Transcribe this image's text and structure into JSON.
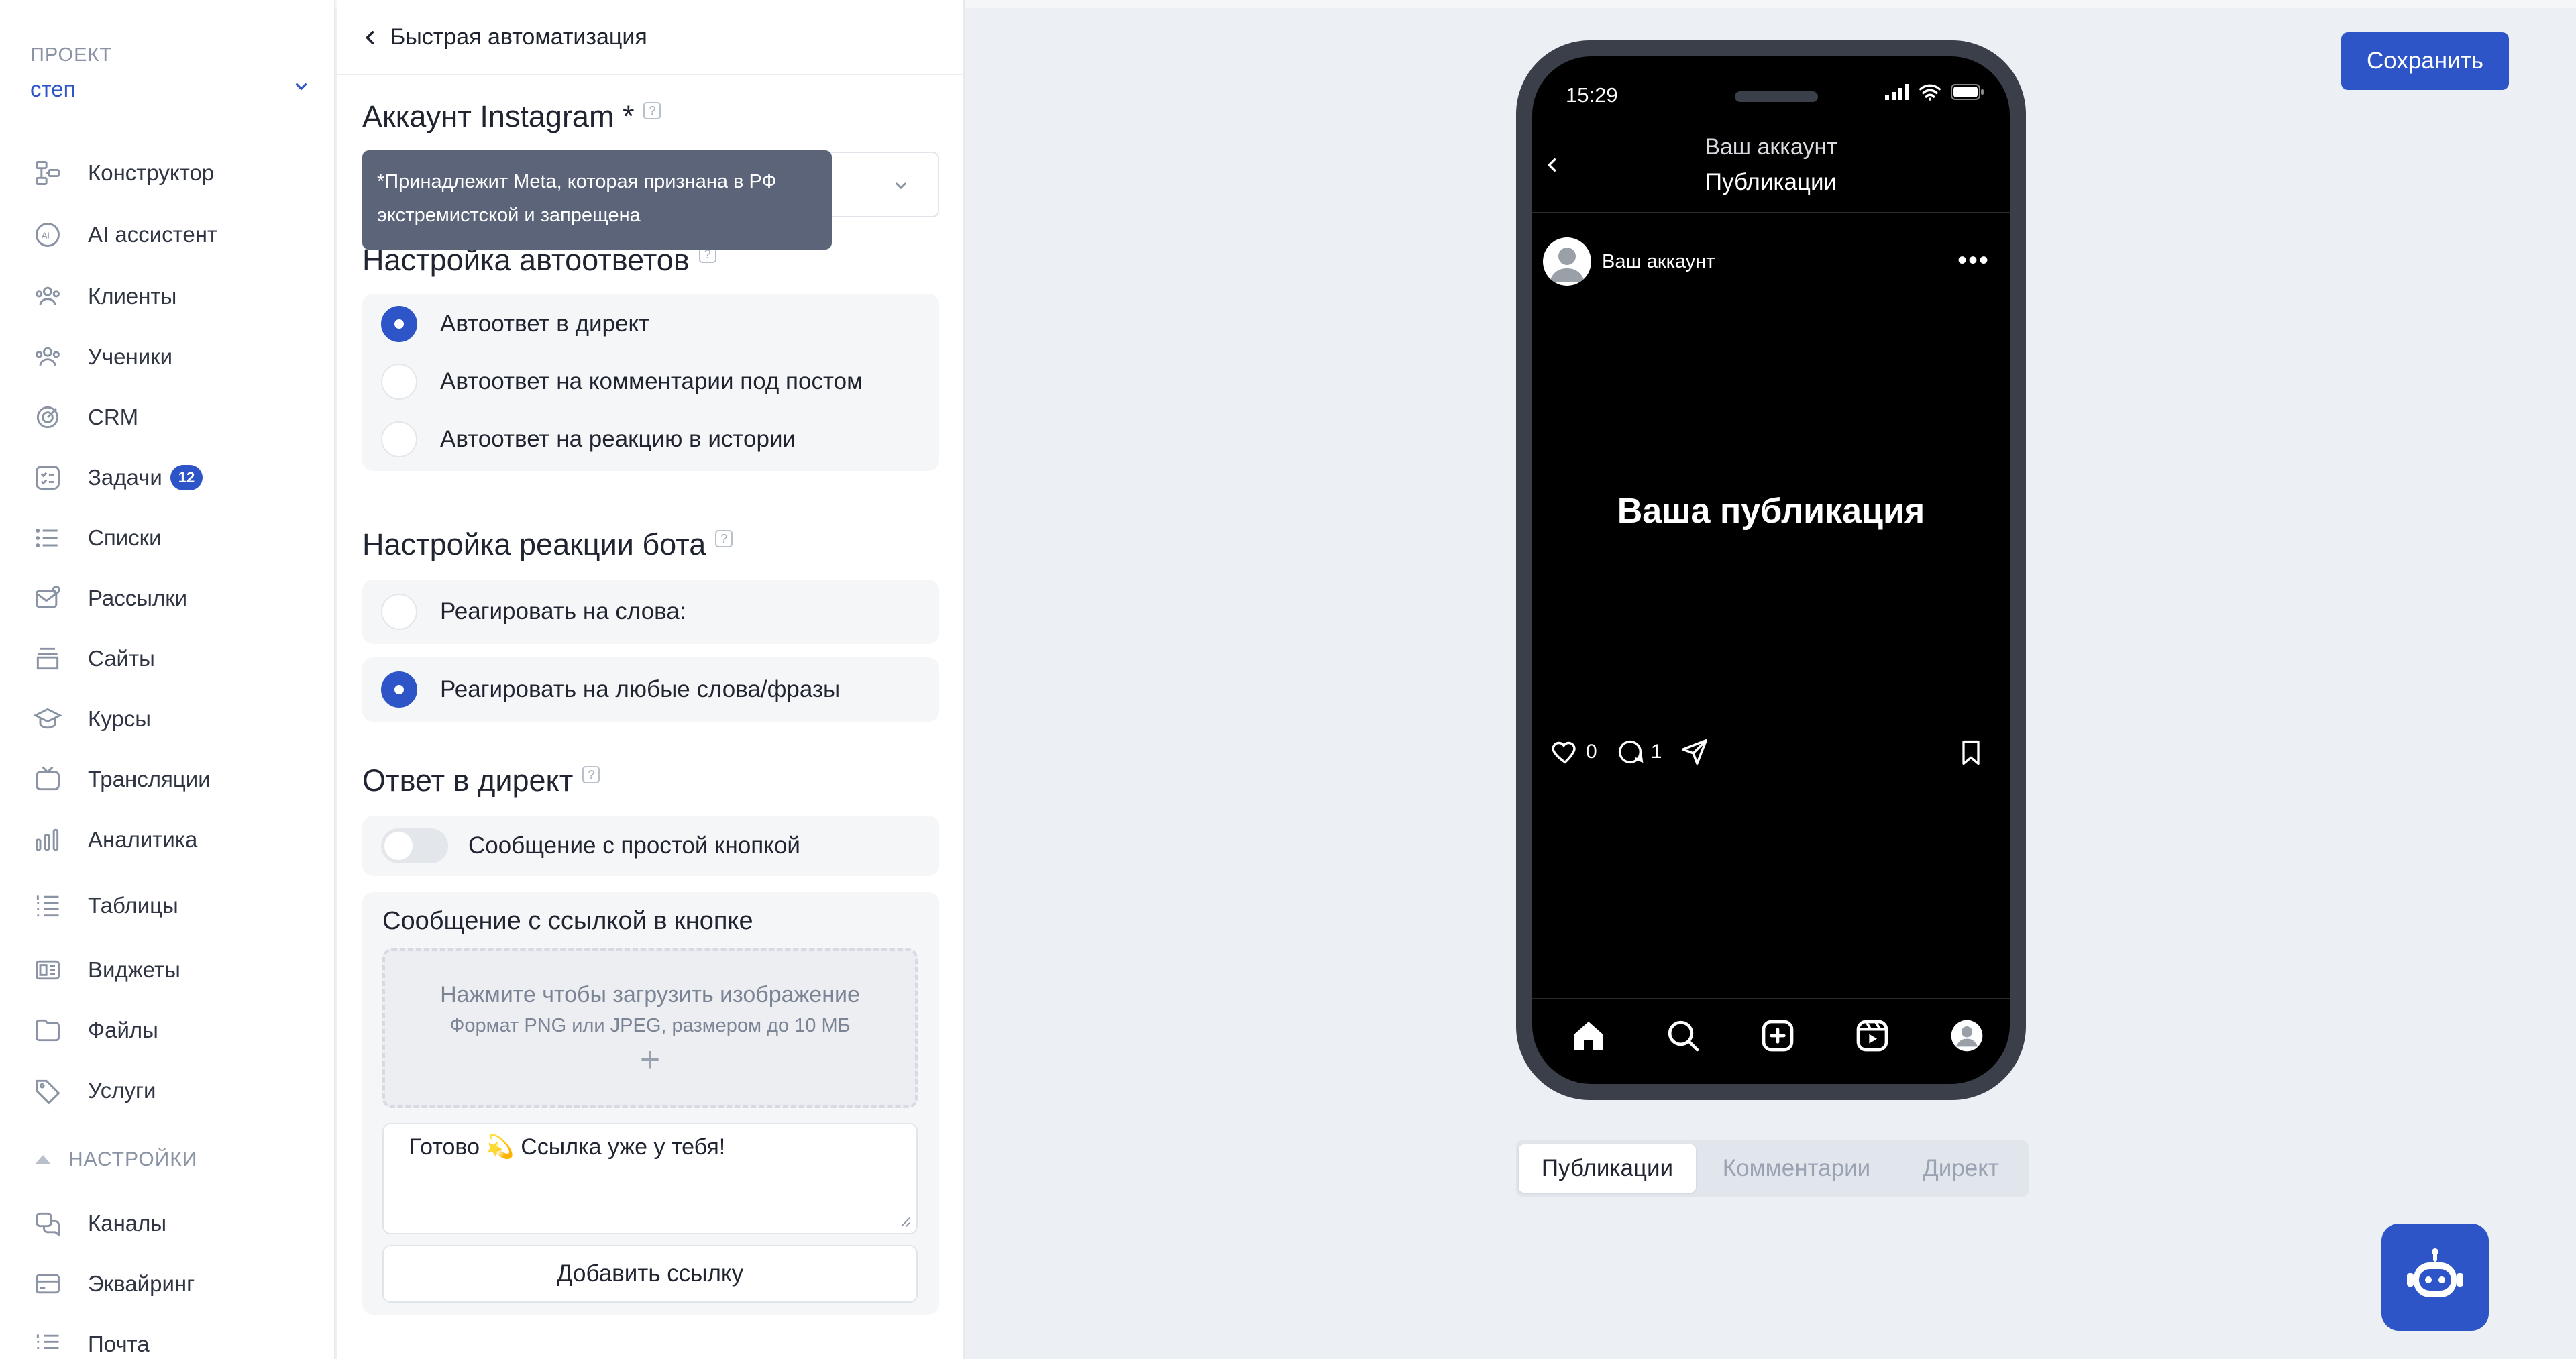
{
  "sidebar": {
    "project_label": "ПРОЕКТ",
    "project_name": "степ",
    "items": [
      {
        "label": "Конструктор",
        "icon": "constructor-icon"
      },
      {
        "label": "AI ассистент",
        "icon": "ai-icon"
      },
      {
        "label": "Клиенты",
        "icon": "clients-icon"
      },
      {
        "label": "Ученики",
        "icon": "students-icon"
      },
      {
        "label": "CRM",
        "icon": "crm-icon"
      },
      {
        "label": "Задачи",
        "icon": "tasks-icon",
        "badge": "12"
      },
      {
        "label": "Списки",
        "icon": "lists-icon"
      },
      {
        "label": "Рассылки",
        "icon": "mailing-icon"
      },
      {
        "label": "Сайты",
        "icon": "sites-icon"
      },
      {
        "label": "Курсы",
        "icon": "courses-icon"
      },
      {
        "label": "Трансляции",
        "icon": "broadcasts-icon"
      },
      {
        "label": "Аналитика",
        "icon": "analytics-icon"
      },
      {
        "label": "Таблицы",
        "icon": "tables-icon"
      },
      {
        "label": "Виджеты",
        "icon": "widgets-icon"
      },
      {
        "label": "Файлы",
        "icon": "files-icon"
      },
      {
        "label": "Услуги",
        "icon": "services-icon"
      }
    ],
    "settings_section": "НАСТРОЙКИ",
    "settings_items": [
      {
        "label": "Каналы",
        "icon": "channels-icon"
      },
      {
        "label": "Эквайринг",
        "icon": "acquiring-icon"
      },
      {
        "label": "Почта",
        "icon": "mail-icon"
      }
    ]
  },
  "panel": {
    "back_label": "Быстрая автоматизация",
    "account_title": "Аккаунт Instagram *",
    "tooltip": "*Принадлежит Meta, которая признана в РФ экстремистской и запрещена",
    "autoreply_title": "Настройка автоответов",
    "autoreply_options": [
      {
        "label": "Автоответ в директ",
        "selected": true
      },
      {
        "label": "Автоответ на комментарии под постом",
        "selected": false
      },
      {
        "label": "Автоответ на реакцию в истории",
        "selected": false
      }
    ],
    "reaction_title": "Настройка реакции бота",
    "reaction_options": [
      {
        "label": "Реагировать на слова:",
        "selected": false
      },
      {
        "label": "Реагировать на любые слова/фразы",
        "selected": true
      }
    ],
    "direct_title": "Ответ в директ",
    "toggle_label": "Сообщение с простой кнопкой",
    "toggle_on": false,
    "message_card_title": "Сообщение с ссылкой в кнопке",
    "upload_title": "Нажмите чтобы загрузить изображение",
    "upload_hint": "Формат PNG или JPEG, размером до 10 МБ",
    "upload_plus": "+",
    "message_text": "Готово 💫 Ссылка уже у тебя!",
    "add_link_label": "Добавить ссылку"
  },
  "preview": {
    "save_label": "Сохранить",
    "status_time": "15:29",
    "account_name_header": "Ваш аккаунт",
    "screen_title": "Публикации",
    "post_username": "Ваш аккаунт",
    "more_glyph": "•••",
    "post_text": "Ваша публикация",
    "likes": "0",
    "comments": "1",
    "tabs": [
      {
        "label": "Публикации",
        "active": true
      },
      {
        "label": "Комментарии",
        "active": false
      },
      {
        "label": "Директ",
        "active": false
      }
    ]
  },
  "colors": {
    "accent": "#2e55c8",
    "tooltip_bg": "#5b6479",
    "page_bg": "#eceff4"
  }
}
